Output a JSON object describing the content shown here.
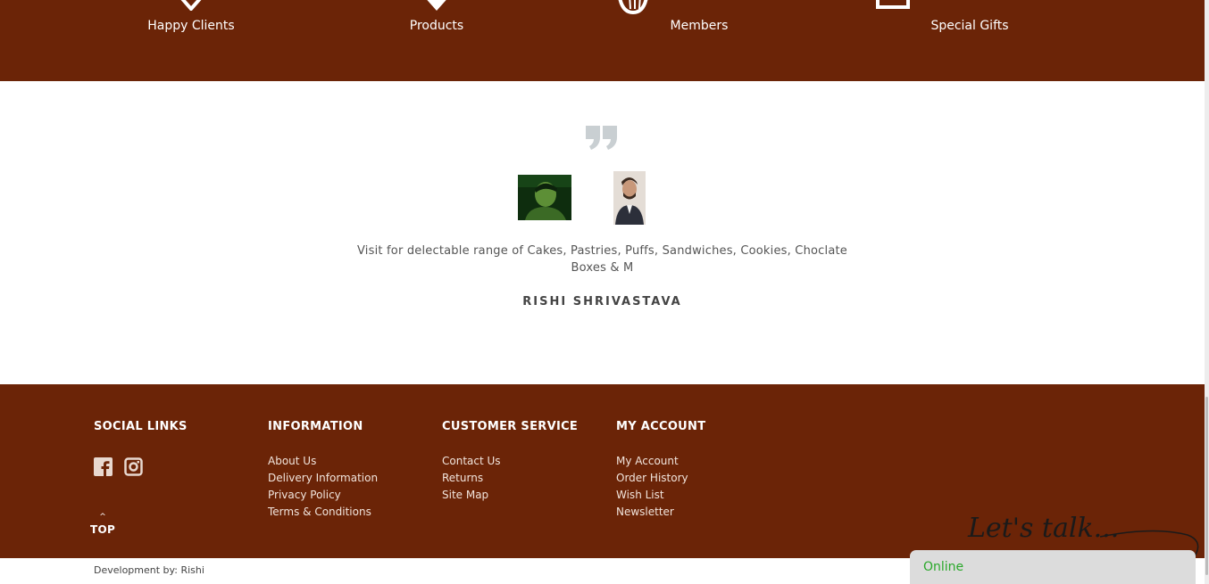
{
  "stats": [
    {
      "label": "Happy Clients",
      "icon": "diamond-icon"
    },
    {
      "label": "Products",
      "icon": "diamond-icon"
    },
    {
      "label": "Members",
      "icon": "cup-icon"
    },
    {
      "label": "Special Gifts",
      "icon": "gift-box-icon"
    }
  ],
  "testimonial": {
    "text": "Visit for delectable range of Cakes, Pastries, Puffs, Sandwiches, Cookies, Choclate Boxes & M",
    "author": "RISHI SHRIVASTAVA"
  },
  "footer": {
    "social": {
      "heading": "SOCIAL LINKS",
      "icons": [
        "facebook-icon",
        "instagram-icon"
      ]
    },
    "information": {
      "heading": "INFORMATION",
      "links": [
        "About Us",
        "Delivery Information",
        "Privacy Policy",
        "Terms & Conditions"
      ]
    },
    "customer_service": {
      "heading": "CUSTOMER SERVICE",
      "links": [
        "Contact Us",
        "Returns",
        "Site Map"
      ]
    },
    "my_account": {
      "heading": "MY ACCOUNT",
      "links": [
        "My Account",
        "Order History",
        "Wish List",
        "Newsletter"
      ]
    },
    "top_label": "TOP",
    "top_arrow": "^"
  },
  "dev_credit": "Development by: Rishi",
  "chat": {
    "script_text": "Let's talk...",
    "status": "Online"
  },
  "colors": {
    "brand_brown": "#6b2407",
    "online_green": "#2aa82a"
  }
}
